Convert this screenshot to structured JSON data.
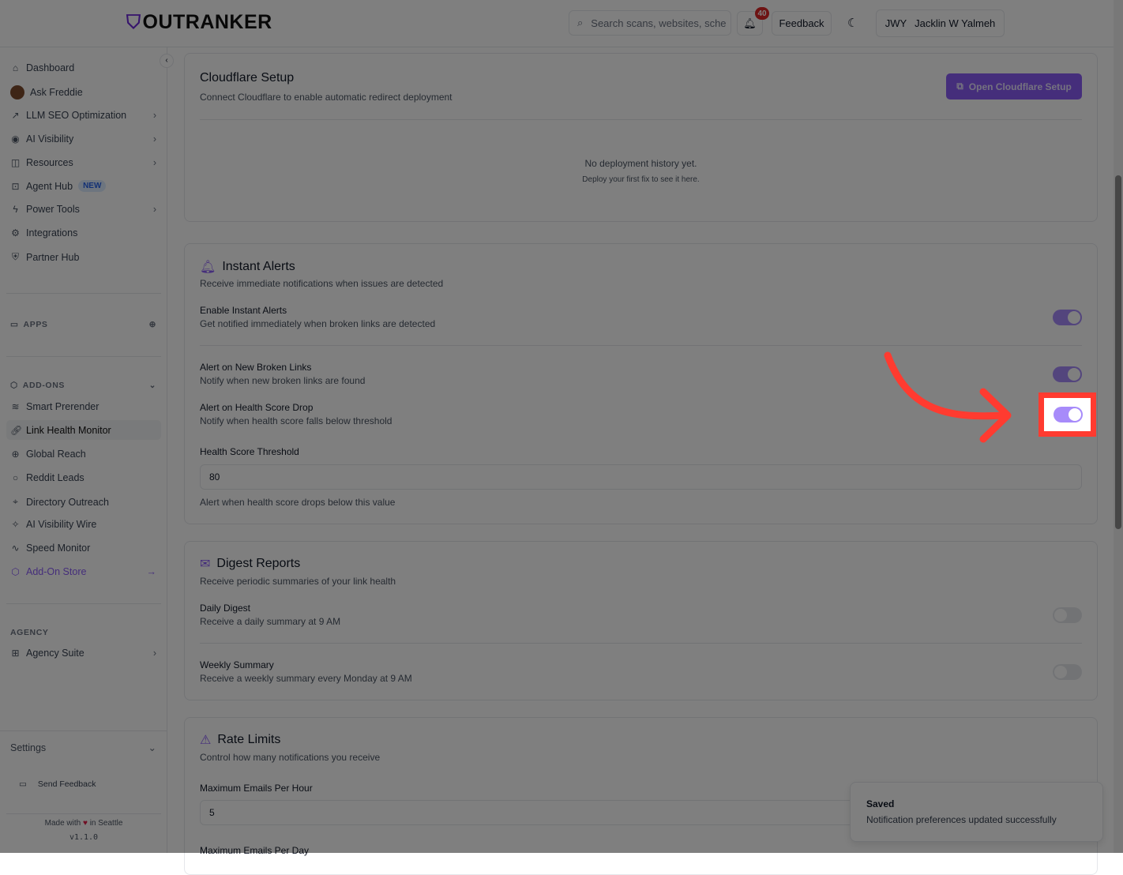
{
  "header": {
    "logo": "OUTRANKER",
    "search_placeholder": "Search scans, websites, sche",
    "notification_count": "40",
    "feedback": "Feedback",
    "user_initials": "JWY",
    "user_name": "Jacklin W Yalmeh"
  },
  "sidebar": {
    "items": [
      {
        "label": "Dashboard"
      },
      {
        "label": "Ask Freddie"
      },
      {
        "label": "LLM SEO Optimization"
      },
      {
        "label": "AI Visibility"
      },
      {
        "label": "Resources"
      },
      {
        "label": "Agent Hub",
        "badge": "NEW"
      },
      {
        "label": "Power Tools"
      },
      {
        "label": "Integrations"
      },
      {
        "label": "Partner Hub"
      }
    ],
    "apps_label": "APPS",
    "addons_label": "ADD-ONS",
    "addons": [
      {
        "label": "Smart Prerender"
      },
      {
        "label": "Link Health Monitor"
      },
      {
        "label": "Global Reach"
      },
      {
        "label": "Reddit Leads"
      },
      {
        "label": "Directory Outreach"
      },
      {
        "label": "AI Visibility Wire"
      },
      {
        "label": "Speed Monitor"
      },
      {
        "label": "Add-On Store"
      }
    ],
    "agency_label": "AGENCY",
    "agency_suite": "Agency Suite",
    "settings": "Settings",
    "send_feedback": "Send Feedback",
    "made_with": "Made with",
    "in_seattle": "in Seattle",
    "version": "v1.1.0"
  },
  "cloudflare": {
    "title": "Cloudflare Setup",
    "subtitle": "Connect Cloudflare to enable automatic redirect deployment",
    "button": "Open Cloudflare Setup",
    "empty_title": "No deployment history yet.",
    "empty_sub": "Deploy your first fix to see it here."
  },
  "instant": {
    "title": "Instant Alerts",
    "subtitle": "Receive immediate notifications when issues are detected",
    "rows": [
      {
        "label": "Enable Instant Alerts",
        "desc": "Get notified immediately when broken links are detected",
        "on": true
      },
      {
        "label": "Alert on New Broken Links",
        "desc": "Notify when new broken links are found",
        "on": true
      },
      {
        "label": "Alert on Health Score Drop",
        "desc": "Notify when health score falls below threshold",
        "on": true
      }
    ],
    "threshold_label": "Health Score Threshold",
    "threshold_value": "80",
    "threshold_help": "Alert when health score drops below this value"
  },
  "digest": {
    "title": "Digest Reports",
    "subtitle": "Receive periodic summaries of your link health",
    "rows": [
      {
        "label": "Daily Digest",
        "desc": "Receive a daily summary at 9 AM",
        "on": false
      },
      {
        "label": "Weekly Summary",
        "desc": "Receive a weekly summary every Monday at 9 AM",
        "on": false
      }
    ]
  },
  "rate": {
    "title": "Rate Limits",
    "subtitle": "Control how many notifications you receive",
    "per_hour_label": "Maximum Emails Per Hour",
    "per_hour_value": "5",
    "per_day_label": "Maximum Emails Per Day"
  },
  "toast": {
    "title": "Saved",
    "message": "Notification preferences updated successfully"
  }
}
